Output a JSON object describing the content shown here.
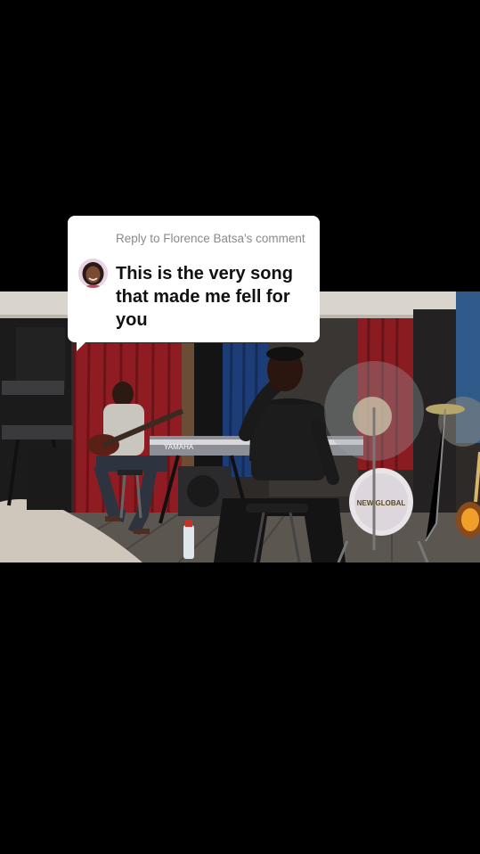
{
  "reply_card": {
    "header": "Reply to Florence Batsa's comment",
    "comment": "This is the very song that made me fell for you",
    "avatar_icon": "user-avatar-icon"
  },
  "video": {
    "scene": "band-performance-frame",
    "keyboard_brand": "YAMAHA",
    "drum_logo": "NEW GLOBAL"
  },
  "colors": {
    "background": "#000000",
    "card": "#ffffff",
    "header_text": "#8a8a8a",
    "comment_text": "#111111"
  }
}
